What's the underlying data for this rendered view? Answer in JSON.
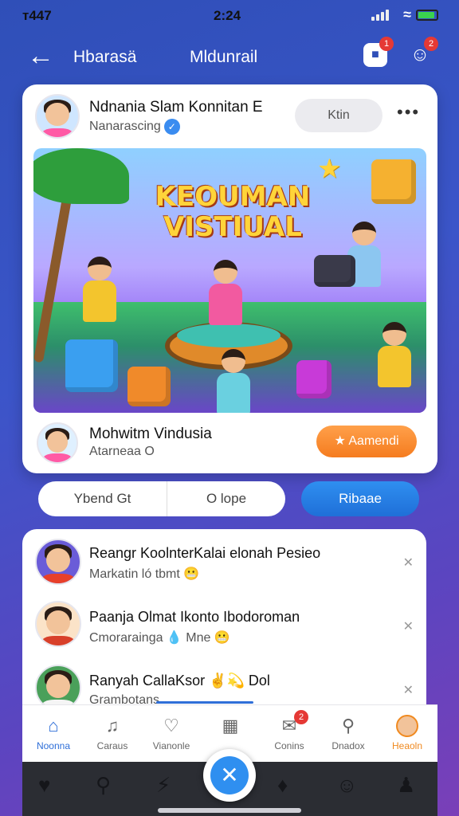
{
  "status_bar": {
    "carrier": "ᴛ447",
    "clock": "2:24"
  },
  "top_nav": {
    "back_icon": "←",
    "title_left": "Hbarasä",
    "title_right": "Mldunrail",
    "notifications_badge": "1",
    "profile_badge": "2"
  },
  "post": {
    "author": "Ndnania Slam Konnitan E",
    "handle": "Nanarascing",
    "follow_label": "Ktin",
    "more_label": "•••",
    "hero_title": "KEOUMAN VISTIUAL",
    "footer_name": "Mohwitm Vindusia",
    "footer_sub": "Atarneaa O",
    "award_label": "★ Aamendi"
  },
  "actions": {
    "left_label": "Ybend Gt",
    "mid_label": "O lope",
    "share_label": "Ribaae"
  },
  "comments": [
    {
      "name": "Reangr KoolnterKalai elonah Pesieo",
      "text": "Markatin ló tbmt 😬"
    },
    {
      "name": "Paanja Olmat Ikonto Ibodoroman",
      "text": "Cmorarainga 💧 Mne 😬"
    },
    {
      "name": "Ranyah CallaKsor ✌️💫 Dol",
      "text": "Grambotans"
    }
  ],
  "tabs": [
    {
      "label": "Noonna",
      "icon": "home-icon"
    },
    {
      "label": "Caraus",
      "icon": "bell-icon"
    },
    {
      "label": "Vianonle",
      "icon": "heart-icon"
    },
    {
      "label": "",
      "icon": "grid-icon"
    },
    {
      "label": "Conins",
      "icon": "chat-icon",
      "badge": "2"
    },
    {
      "label": "Dnadox",
      "icon": "search-icon"
    },
    {
      "label": "Heaoln",
      "icon": "avatar"
    }
  ],
  "colors": {
    "accent": "#2f6fd8",
    "award": "#f57c1f",
    "background": "#3b55c9"
  }
}
